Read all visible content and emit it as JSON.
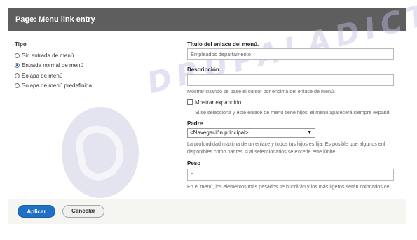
{
  "dialog": {
    "title": "Page: Menu link entry"
  },
  "watermark": {
    "text": "DRUPALADICTO"
  },
  "tipo": {
    "label": "Tipo",
    "options": [
      {
        "label": "Sin entrada de menú",
        "checked": false
      },
      {
        "label": "Entrada normal de menú",
        "checked": true
      },
      {
        "label": "Solapa de menú",
        "checked": false
      },
      {
        "label": "Solapa de menú predefinida",
        "checked": false
      }
    ]
  },
  "form": {
    "titulo": {
      "label": "Título del enlace del menú.",
      "value": "Empleados departamento"
    },
    "descripcion": {
      "label": "Descripción",
      "value": "",
      "help": "Mostrar cuando se pase el cursor por encima del enlace de menú."
    },
    "expandido": {
      "label": "Mostrar expandido",
      "checked": false,
      "help": "Si se selecciona y este enlace de menú tiene hijos, el menú aparecerá siempre expandi"
    },
    "padre": {
      "label": "Padre",
      "selected": "<Navegación principal>",
      "help_line1": "La profundidad máxima de un enlace y todos tus hijos es fija. Es posible que algunos enl",
      "help_line2": "disponibles como padres si al seleccionarlos se excede este límite."
    },
    "peso": {
      "label": "Peso",
      "value": "0",
      "help": "En el menú, los elementos más pesados se hundirán y los más ligeros serán colocados ce"
    }
  },
  "footer": {
    "apply_label": "Aplicar",
    "cancel_label": "Cancelar"
  },
  "colors": {
    "titlebar": "#5e5e5e",
    "primary": "#1f6fc5",
    "footer": "#f5f5f2"
  }
}
